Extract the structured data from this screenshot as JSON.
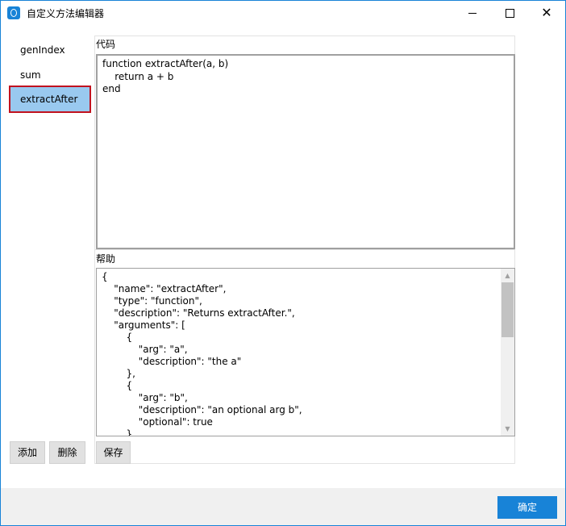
{
  "window": {
    "title": "自定义方法编辑器"
  },
  "methods": [
    {
      "label": "genIndex",
      "selected": false
    },
    {
      "label": "sum",
      "selected": false
    },
    {
      "label": "extractAfter",
      "selected": true
    }
  ],
  "code_panel": {
    "label": "代码",
    "content": "function extractAfter(a, b)\n    return a + b\nend"
  },
  "help_panel": {
    "label": "帮助",
    "content": "{\n    \"name\": \"extractAfter\",\n    \"type\": \"function\",\n    \"description\": \"Returns extractAfter.\",\n    \"arguments\": [\n        {\n            \"arg\": \"a\",\n            \"description\": \"the a\"\n        },\n        {\n            \"arg\": \"b\",\n            \"description\": \"an optional arg b\",\n            \"optional\": true\n        }"
  },
  "buttons": {
    "add": "添加",
    "delete": "删除",
    "save": "保存",
    "ok": "确定"
  },
  "colors": {
    "accent": "#1883d7",
    "selection": "#99c9ef",
    "highlight_border": "#c1121f"
  }
}
